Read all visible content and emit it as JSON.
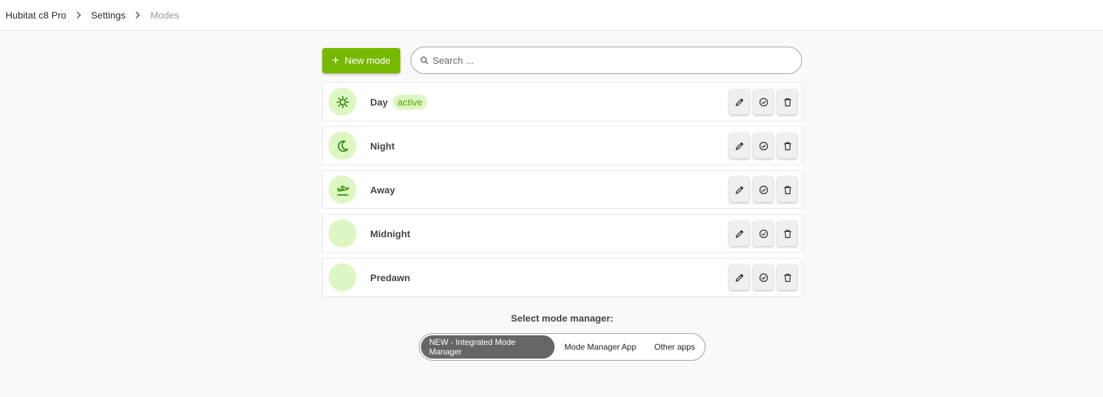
{
  "breadcrumb": {
    "items": [
      "Hubitat c8 Pro",
      "Settings",
      "Modes"
    ]
  },
  "toolbar": {
    "new_label": "New mode",
    "search_placeholder": "Search ..."
  },
  "modes": [
    {
      "name": "Day",
      "icon": "sun-icon",
      "badge": "active"
    },
    {
      "name": "Night",
      "icon": "moon-icon",
      "badge": ""
    },
    {
      "name": "Away",
      "icon": "plane-departure-icon",
      "badge": ""
    },
    {
      "name": "Midnight",
      "icon": "",
      "badge": ""
    },
    {
      "name": "Predawn",
      "icon": "",
      "badge": ""
    }
  ],
  "manager": {
    "label": "Select mode manager:",
    "options": [
      "NEW - Integrated Mode Manager",
      "Mode Manager App",
      "Other apps"
    ],
    "selected": "NEW - Integrated Mode Manager"
  },
  "colors": {
    "accent": "#76b900",
    "icon_bg": "#ddf7c4",
    "icon_fg": "#2e8b00",
    "badge_text": "#5aa000"
  }
}
